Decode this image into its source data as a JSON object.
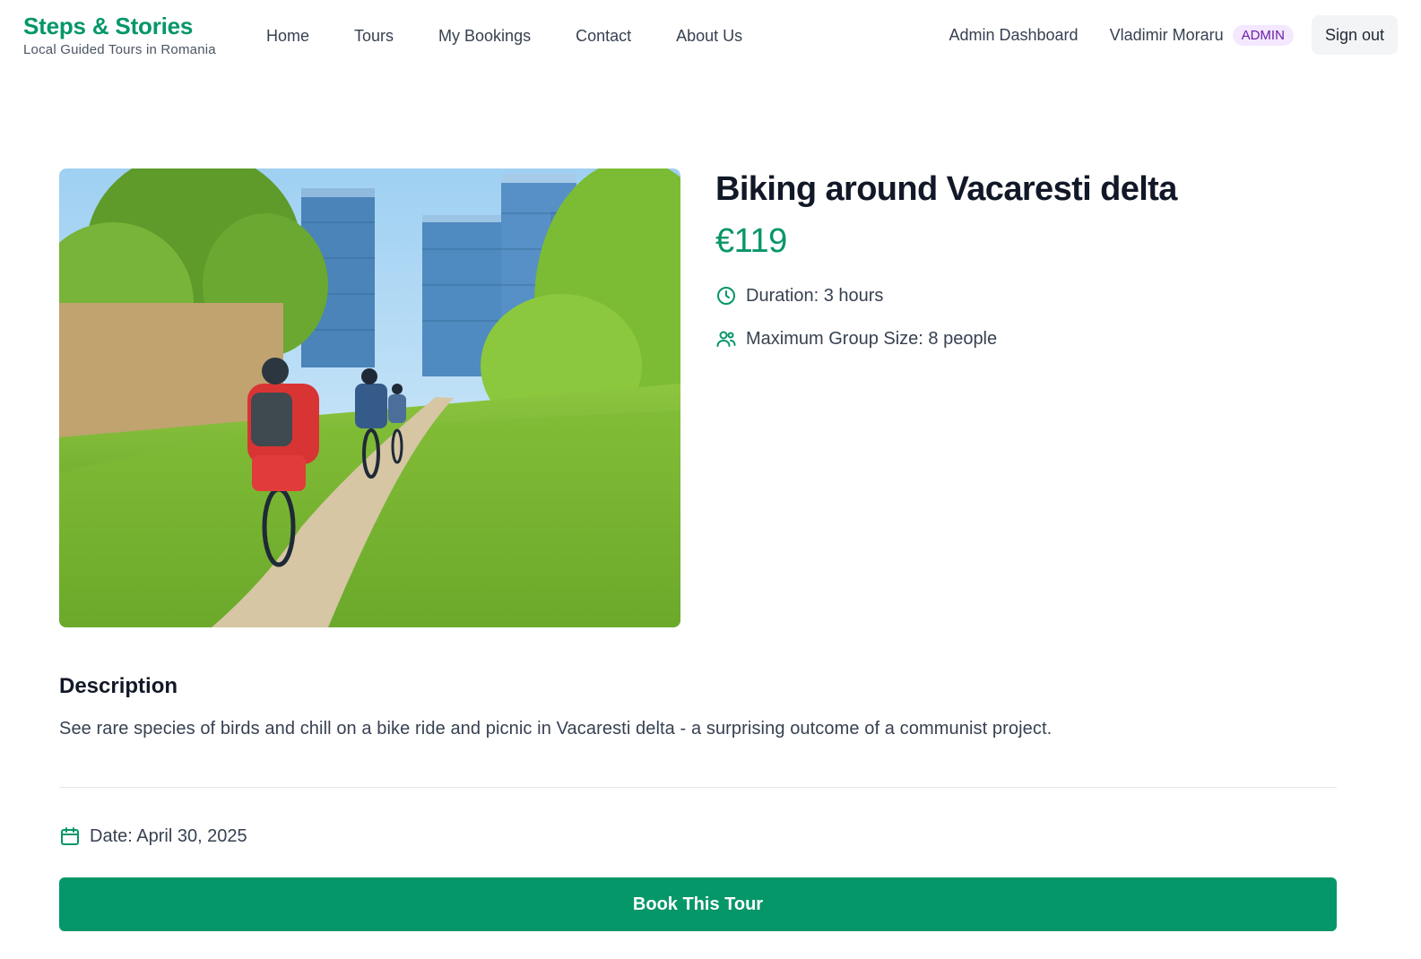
{
  "brand": {
    "title": "Steps & Stories",
    "subtitle": "Local Guided Tours in Romania"
  },
  "nav": {
    "items": [
      "Home",
      "Tours",
      "My Bookings",
      "Contact",
      "About Us"
    ]
  },
  "header_right": {
    "admin_dashboard": "Admin Dashboard",
    "user_name": "Vladimir Moraru",
    "role_badge": "ADMIN",
    "sign_out": "Sign out"
  },
  "tour": {
    "title": "Biking around Vacaresti delta",
    "price": "€119",
    "duration": "Duration: 3 hours",
    "group_size": "Maximum Group Size: 8 people",
    "description_heading": "Description",
    "description": "See rare species of birds and chill on a bike ride and picnic in Vacaresti delta - a surprising outcome of a communist project.",
    "date": "Date: April 30, 2025",
    "book_button": "Book This Tour"
  },
  "colors": {
    "brand": "#059669",
    "badge_bg": "#f3e8ff",
    "badge_text": "#6b21a8"
  },
  "icons": {
    "duration": "clock-icon",
    "group": "users-icon",
    "date": "calendar-icon"
  }
}
